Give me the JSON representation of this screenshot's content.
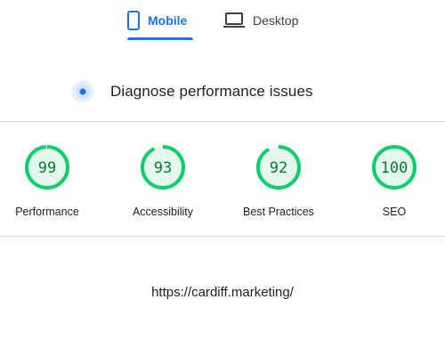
{
  "tabs": [
    {
      "label": "Mobile",
      "icon": "smartphone-icon",
      "selected": true
    },
    {
      "label": "Desktop",
      "icon": "laptop-icon",
      "selected": false
    }
  ],
  "diagnose": {
    "text": "Diagnose performance issues",
    "icon": "pulse-dot-icon"
  },
  "scores": [
    {
      "label": "Performance",
      "value": "99",
      "fraction": 0.99
    },
    {
      "label": "Accessibility",
      "value": "93",
      "fraction": 0.93
    },
    {
      "label": "Best Practices",
      "value": "92",
      "fraction": 0.92
    },
    {
      "label": "SEO",
      "value": "100",
      "fraction": 1.0
    }
  ],
  "url": "https://cardiff.marketing/",
  "colors": {
    "accent": "#1a73e8",
    "pass": "#0cce6b",
    "pass_track": "#e5f8ee",
    "pass_text": "#0a7c2f"
  }
}
